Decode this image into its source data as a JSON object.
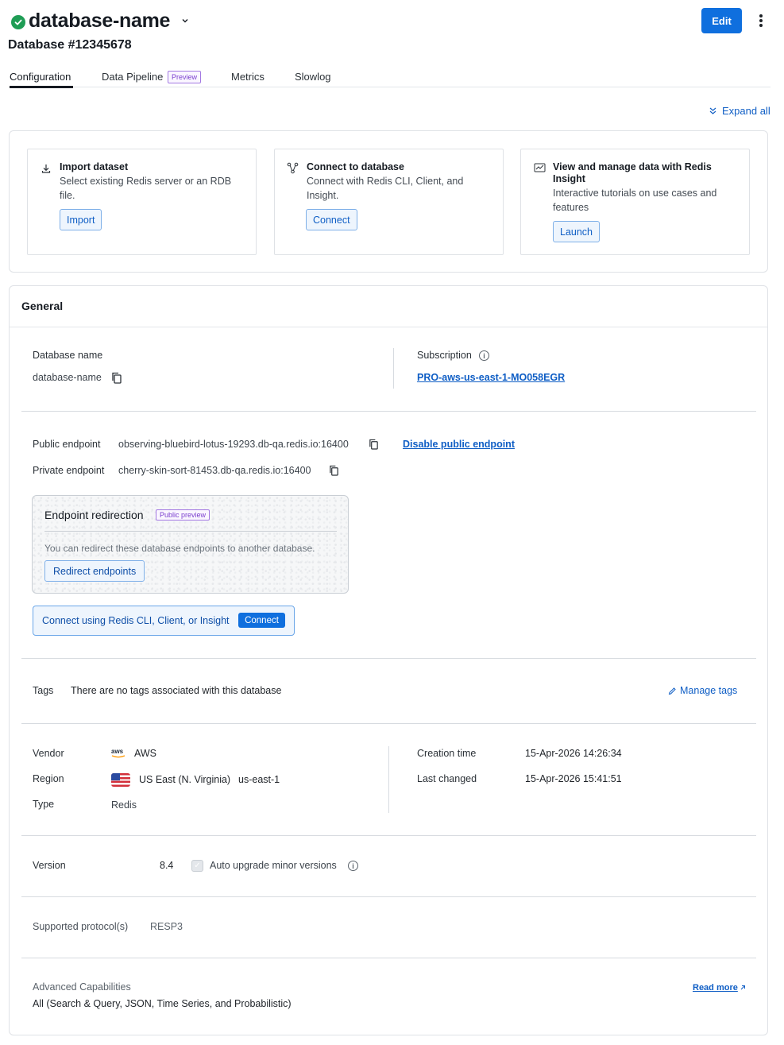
{
  "header": {
    "db_name": "database-name",
    "db_id": "Database #12345678",
    "edit_label": "Edit"
  },
  "tabs": [
    {
      "label": "Configuration",
      "active": true
    },
    {
      "label": "Data Pipeline",
      "badge": "Preview"
    },
    {
      "label": "Metrics"
    },
    {
      "label": "Slowlog"
    }
  ],
  "expand_all": "Expand all",
  "quick_actions": [
    {
      "title": "Import dataset",
      "description": "Select existing Redis server or an RDB file.",
      "button": "Import",
      "icon": "import-icon"
    },
    {
      "title": "Connect to database",
      "description": "Connect with Redis CLI, Client, and Insight.",
      "button": "Connect",
      "icon": "connect-icon"
    },
    {
      "title": "View and manage data with Redis Insight",
      "description": "Interactive tutorials on use cases and features",
      "button": "Launch",
      "icon": "chart-icon"
    }
  ],
  "general": {
    "title": "General",
    "database_name_label": "Database name",
    "database_name_value": "database-name",
    "subscription_label": "Subscription",
    "subscription_value": "PRO-aws-us-east-1-MO058EGR",
    "public_endpoint_label": "Public endpoint",
    "public_endpoint_value": "observing-bluebird-lotus-19293.db-qa.redis.io:16400",
    "disable_public_label": "Disable public endpoint",
    "private_endpoint_label": "Private endpoint",
    "private_endpoint_value": "cherry-skin-sort-81453.db-qa.redis.io:16400",
    "redirection": {
      "title": "Endpoint redirection",
      "badge": "Public preview",
      "description": "You can redirect these database endpoints to another database.",
      "button": "Redirect endpoints"
    },
    "connect_strip": {
      "text": "Connect using Redis CLI, Client, or Insight",
      "button": "Connect"
    },
    "tags_label": "Tags",
    "tags_value": "There are no tags associated with this database",
    "manage_tags": "Manage tags",
    "vendor_label": "Vendor",
    "vendor_logo": "aws",
    "vendor_value": "AWS",
    "region_label": "Region",
    "region_value": "US East (N. Virginia)",
    "region_code": "us-east-1",
    "type_label": "Type",
    "type_value": "Redis",
    "creation_label": "Creation time",
    "creation_value": "15-Apr-2026 14:26:34",
    "changed_label": "Last changed",
    "changed_value": "15-Apr-2026 15:41:51",
    "version_label": "Version",
    "version_value": "8.4",
    "auto_upgrade_label": "Auto upgrade minor versions",
    "protocol_label": "Supported protocol(s)",
    "protocol_value": "RESP3",
    "advanced_label": "Advanced Capabilities",
    "advanced_value": "All (Search & Query, JSON, Time Series, and Probabilistic)",
    "read_more": "Read more"
  },
  "colors": {
    "accent": "#0f6fde",
    "status_ok": "#1f9d55",
    "preview_badge": "#7b3fcf"
  }
}
